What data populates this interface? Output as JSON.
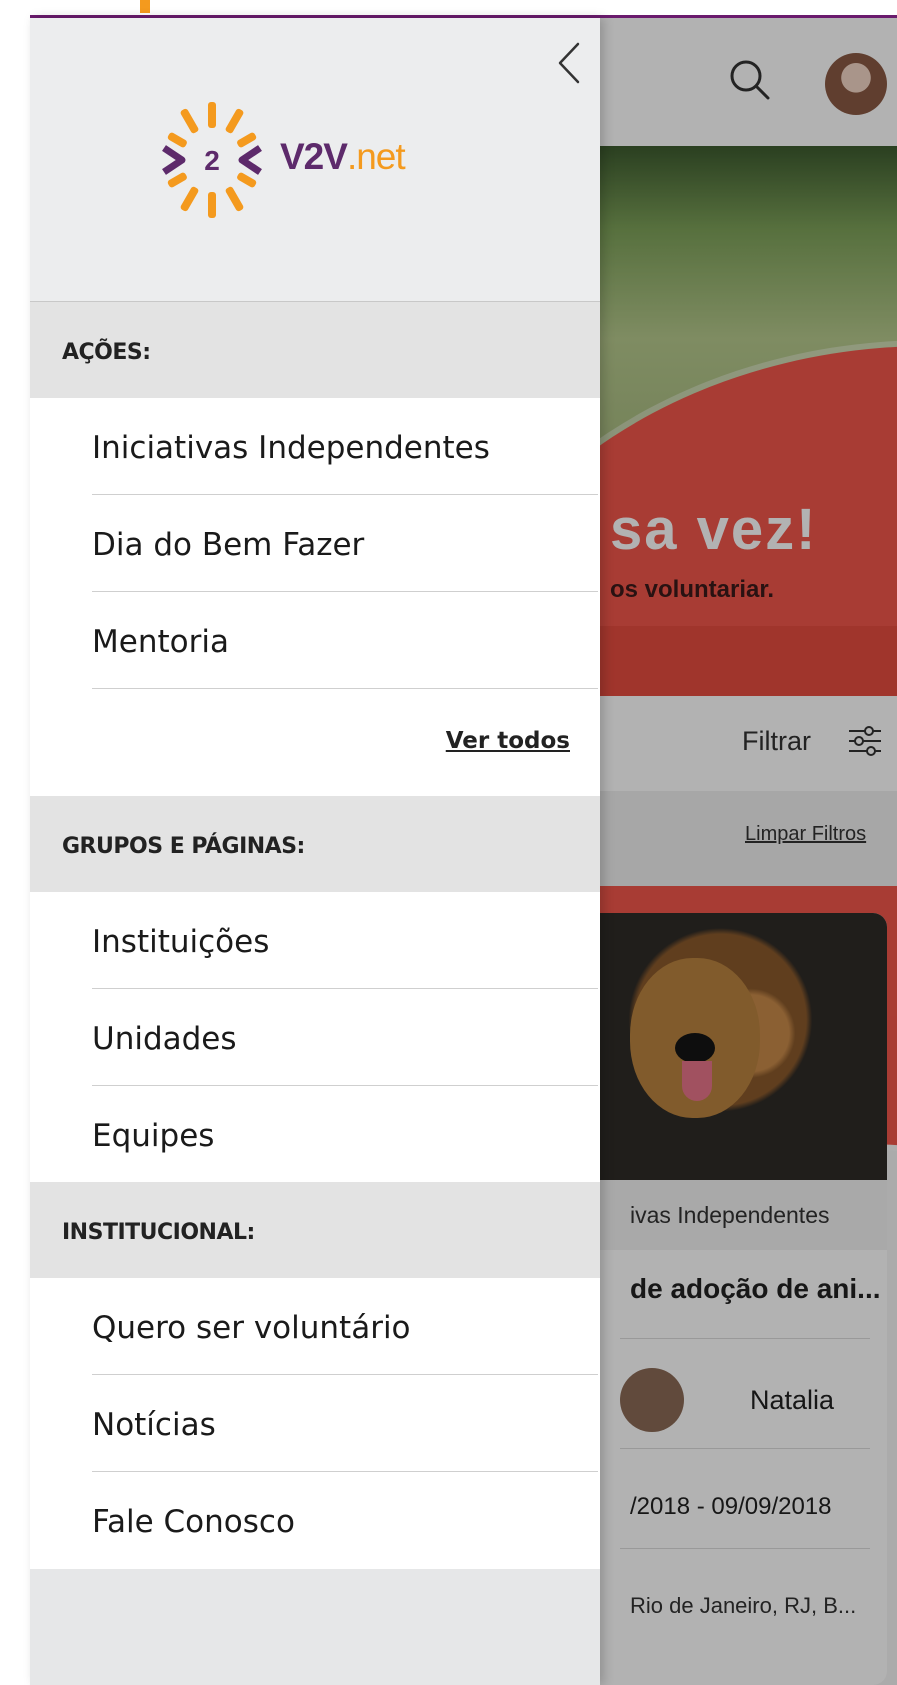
{
  "app": {
    "banner_title": "sa vez!",
    "banner_subtitle": "os voluntariar.",
    "filter_label": "Filtrar",
    "clear_filters_label": "Limpar Filtros",
    "card": {
      "category": "ivas Independentes",
      "title": "de adoção de ani...",
      "author": "Natalia",
      "dates": "/2018 - 09/09/2018",
      "location": "Rio de Janeiro, RJ, B..."
    }
  },
  "drawer": {
    "logo_text_main": "V2V",
    "logo_text_suffix": ".net",
    "logo_digit": "2",
    "sections": [
      {
        "title": "AÇÕES:",
        "items": [
          "Iniciativas Independentes",
          "Dia do Bem Fazer",
          "Mentoria"
        ],
        "see_all": "Ver todos"
      },
      {
        "title": "GRUPOS E PÁGINAS:",
        "items": [
          "Instituições",
          "Unidades",
          "Equipes"
        ]
      },
      {
        "title": "INSTITUCIONAL:",
        "items": [
          "Quero ser voluntário",
          "Notícias",
          "Fale Conosco"
        ]
      }
    ]
  },
  "colors": {
    "brand_purple": "#5d2a6b",
    "brand_orange": "#f49a1e",
    "banner_red": "#f1574b"
  },
  "icons": [
    "search-icon",
    "filter-icon",
    "chevron-left-icon",
    "logo-icon"
  ]
}
